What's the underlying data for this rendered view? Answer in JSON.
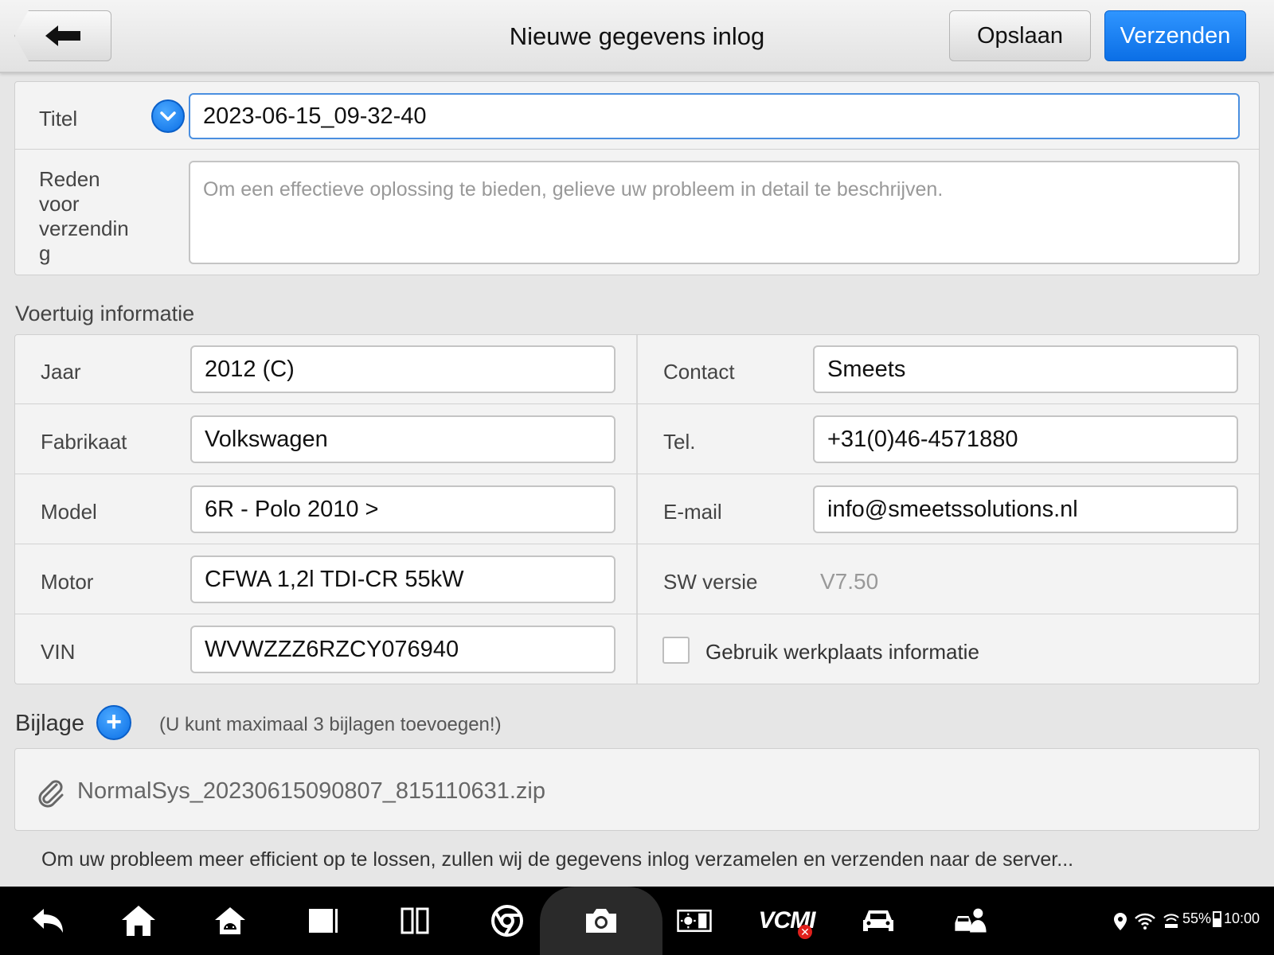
{
  "header": {
    "title": "Nieuwe gegevens inlog",
    "save_label": "Opslaan",
    "send_label": "Verzenden"
  },
  "form": {
    "titel_label": "Titel",
    "titel_value": "2023-06-15_09-32-40",
    "reason_label_lines": [
      "Reden",
      "voor",
      "verzendin",
      "g"
    ],
    "reason_placeholder": "Om een effectieve oplossing te bieden, gelieve uw probleem in detail te beschrijven."
  },
  "vehicle": {
    "section_title": "Voertuig informatie",
    "left": [
      {
        "label": "Jaar",
        "value": "2012 (C)"
      },
      {
        "label": "Fabrikaat",
        "value": "Volkswagen"
      },
      {
        "label": "Model",
        "value": "6R - Polo  2010 >"
      },
      {
        "label": "Motor",
        "value": "CFWA 1,2l TDI-CR 55kW"
      },
      {
        "label": "VIN",
        "value": "WVWZZZ6RZCY076940"
      }
    ],
    "right": [
      {
        "label": "Contact",
        "value": "Smeets"
      },
      {
        "label": "Tel.",
        "value": "+31(0)46-4571880"
      },
      {
        "label": "E-mail",
        "value": "info@smeetssolutions.nl"
      },
      {
        "label": "SW versie",
        "value": "V7.50"
      }
    ],
    "workshop_checkbox_label": "Gebruik werkplaats informatie",
    "workshop_checked": false
  },
  "attachment": {
    "section_title": "Bijlage",
    "hint": "(U kunt maximaal 3 bijlagen toevoegen!)",
    "file_name": "NormalSys_20230615090807_815110631.zip"
  },
  "footer_note": "Om uw probleem meer efficient op te lossen, zullen wij de gegevens inlog verzamelen en verzenden naar de server...",
  "taskbar": {
    "icons": [
      "back-icon",
      "home-icon",
      "android-home-icon",
      "recent-apps-icon",
      "split-screen-icon",
      "browser-icon",
      "camera-icon",
      "display-settings-icon",
      "vcm-icon",
      "vehicle-icon",
      "technician-icon"
    ],
    "vcm_label": "VCMI",
    "battery": "55%",
    "time": "10:00"
  },
  "colors": {
    "accent": "#0b6fe6",
    "background": "#e6e6e6",
    "panel": "#f3f3f3",
    "taskbar": "#000000"
  }
}
